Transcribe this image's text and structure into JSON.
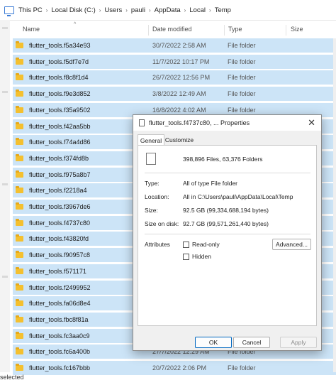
{
  "breadcrumb": [
    "This PC",
    "Local Disk (C:)",
    "Users",
    "pauli",
    "AppData",
    "Local",
    "Temp"
  ],
  "columns": {
    "name": "Name",
    "date": "Date modified",
    "type": "Type",
    "size": "Size"
  },
  "rows": [
    {
      "name": "flutter_tools.f5a34e93",
      "date": "30/7/2022 2:58 AM",
      "type": "File folder"
    },
    {
      "name": "flutter_tools.f5df7e7d",
      "date": "11/7/2022 10:17 PM",
      "type": "File folder"
    },
    {
      "name": "flutter_tools.f8c8f1d4",
      "date": "26/7/2022 12:56 PM",
      "type": "File folder"
    },
    {
      "name": "flutter_tools.f9e3d852",
      "date": "3/8/2022 12:49 AM",
      "type": "File folder"
    },
    {
      "name": "flutter_tools.f35a9502",
      "date": "16/8/2022 4:02 AM",
      "type": "File folder"
    },
    {
      "name": "flutter_tools.f42aa5bb",
      "date": "",
      "type": ""
    },
    {
      "name": "flutter_tools.f74a4d86",
      "date": "",
      "type": ""
    },
    {
      "name": "flutter_tools.f374fd8b",
      "date": "",
      "type": ""
    },
    {
      "name": "flutter_tools.f975a8b7",
      "date": "",
      "type": ""
    },
    {
      "name": "flutter_tools.f2218a4",
      "date": "",
      "type": ""
    },
    {
      "name": "flutter_tools.f3967de6",
      "date": "",
      "type": ""
    },
    {
      "name": "flutter_tools.f4737c80",
      "date": "",
      "type": ""
    },
    {
      "name": "flutter_tools.f43820fd",
      "date": "",
      "type": ""
    },
    {
      "name": "flutter_tools.f90957c8",
      "date": "",
      "type": ""
    },
    {
      "name": "flutter_tools.f571171",
      "date": "",
      "type": ""
    },
    {
      "name": "flutter_tools.f2499952",
      "date": "",
      "type": ""
    },
    {
      "name": "flutter_tools.fa06d8e4",
      "date": "",
      "type": ""
    },
    {
      "name": "flutter_tools.fbc8f81a",
      "date": "",
      "type": ""
    },
    {
      "name": "flutter_tools.fc3aa0c9",
      "date": "",
      "type": ""
    },
    {
      "name": "flutter_tools.fc6a400b",
      "date": "27/7/2022 12:29 AM",
      "type": "File folder"
    },
    {
      "name": "flutter_tools.fc167bbb",
      "date": "20/7/2022 2:06 PM",
      "type": "File folder"
    }
  ],
  "status": "selected",
  "dialog": {
    "title": "flutter_tools.f4737c80, ... Properties",
    "close": "✕",
    "tabs": [
      "General",
      "Customize"
    ],
    "summary": "398,896 Files, 63,376 Folders",
    "fields": [
      {
        "label": "Type:",
        "value": "All of type File folder"
      },
      {
        "label": "Location:",
        "value": "All in C:\\Users\\pauli\\AppData\\Local\\Temp"
      },
      {
        "label": "Size:",
        "value": "92.5 GB (99,334,688,194 bytes)"
      },
      {
        "label": "Size on disk:",
        "value": "92.7 GB (99,571,261,440 bytes)"
      }
    ],
    "attributes_label": "Attributes",
    "read_only": "Read-only",
    "hidden": "Hidden",
    "advanced": "Advanced...",
    "ok": "OK",
    "cancel": "Cancel",
    "apply": "Apply"
  }
}
